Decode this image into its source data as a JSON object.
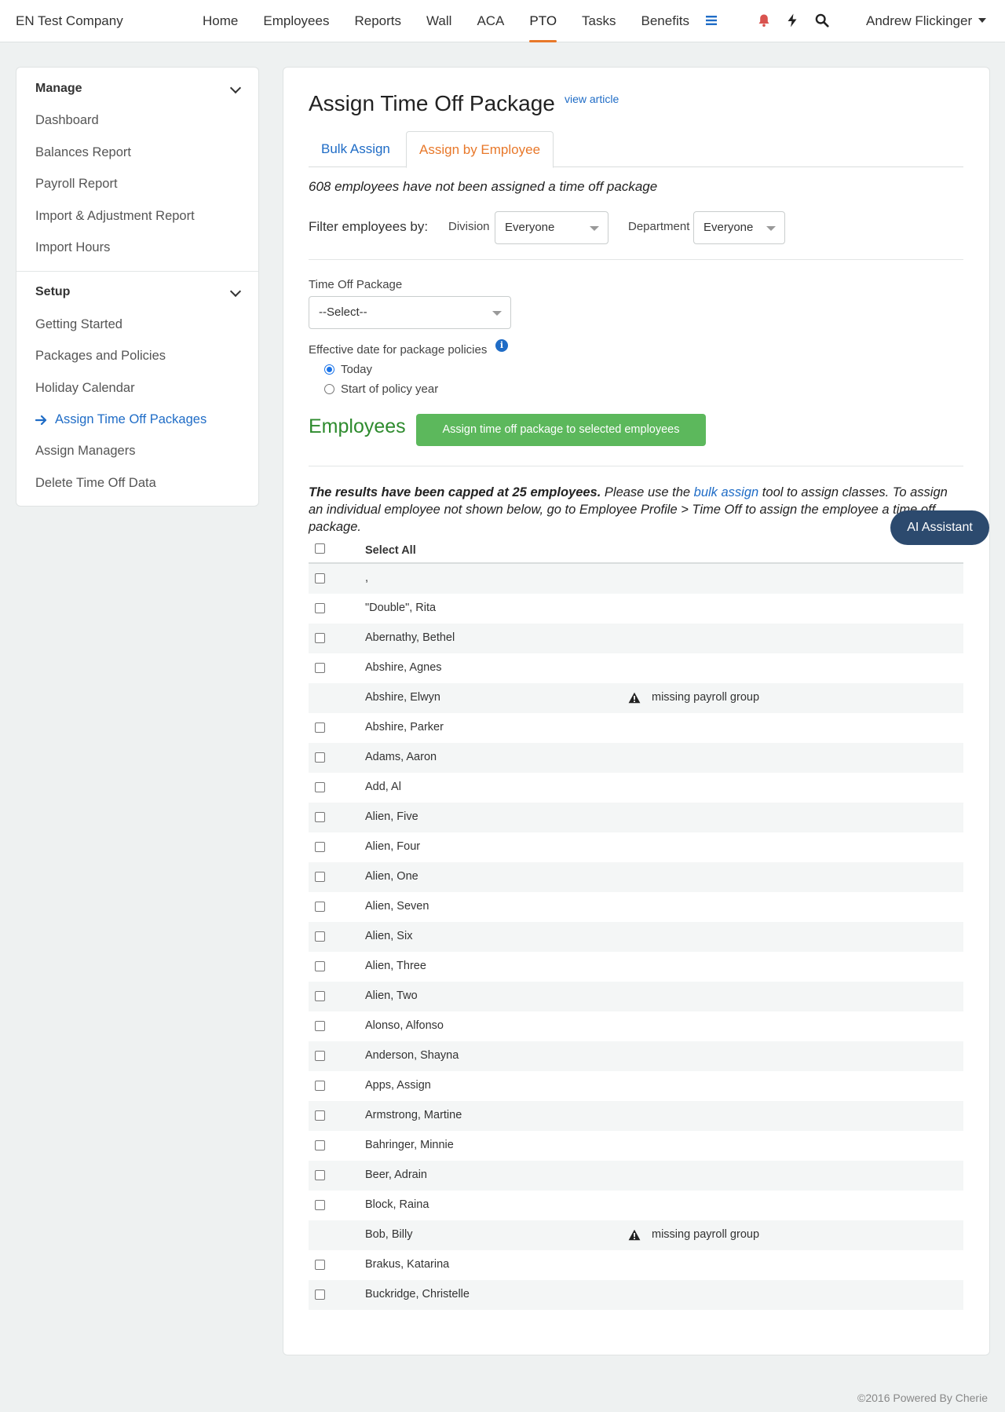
{
  "header": {
    "company": "EN Test Company",
    "nav": [
      "Home",
      "Employees",
      "Reports",
      "Wall",
      "ACA",
      "PTO",
      "Tasks",
      "Benefits"
    ],
    "active_nav": "PTO",
    "user": "Andrew Flickinger",
    "icons": [
      "menu-icon",
      "bell-icon",
      "lightning-icon",
      "search-icon"
    ],
    "colors": {
      "accent": "#e8782a",
      "bell": "#d9534f",
      "menu": "#1f6cc6"
    }
  },
  "sidebar": {
    "manage_title": "Manage",
    "manage_items": [
      "Dashboard",
      "Balances Report",
      "Payroll Report",
      "Import & Adjustment Report",
      "Import Hours"
    ],
    "setup_title": "Setup",
    "setup_items": [
      "Getting Started",
      "Packages and Policies",
      "Holiday Calendar",
      "Assign Time Off Packages",
      "Assign Managers",
      "Delete Time Off Data"
    ],
    "active_item": "Assign Time Off Packages"
  },
  "main": {
    "title": "Assign Time Off Package",
    "view_article": "view article",
    "tabs": [
      "Bulk Assign",
      "Assign by Employee"
    ],
    "active_tab": "Assign by Employee",
    "unassigned_notice": "608 employees have not been assigned a time off package",
    "filter_label": "Filter employees by:",
    "division_label": "Division",
    "division_value": "Everyone",
    "department_label": "Department",
    "department_value": "Everyone",
    "package_label": "Time Off Package",
    "package_value": "--Select--",
    "effective_label": "Effective date for package policies",
    "effective_options": [
      "Today",
      "Start of policy year"
    ],
    "effective_selected": "Today",
    "employees_heading": "Employees",
    "assign_button": "Assign time off package to selected employees",
    "capped_bold": "The results have been capped at 25 employees.",
    "capped_text1": " Please use the ",
    "capped_link": "bulk assign",
    "capped_text2": " tool to assign classes. To assign an individual employee not shown below, go to Employee Profile > Time Off to assign the employee a time off package.",
    "select_all": "Select All",
    "employees": [
      {
        "name": ",",
        "checkbox": true,
        "warning": ""
      },
      {
        "name": "\"Double\", Rita",
        "checkbox": true,
        "warning": ""
      },
      {
        "name": "Abernathy, Bethel",
        "checkbox": true,
        "warning": ""
      },
      {
        "name": "Abshire, Agnes",
        "checkbox": true,
        "warning": ""
      },
      {
        "name": "Abshire, Elwyn",
        "checkbox": false,
        "warning": "missing payroll group"
      },
      {
        "name": "Abshire, Parker",
        "checkbox": true,
        "warning": ""
      },
      {
        "name": "Adams, Aaron",
        "checkbox": true,
        "warning": ""
      },
      {
        "name": "Add, Al",
        "checkbox": true,
        "warning": ""
      },
      {
        "name": "Alien, Five",
        "checkbox": true,
        "warning": ""
      },
      {
        "name": "Alien, Four",
        "checkbox": true,
        "warning": ""
      },
      {
        "name": "Alien, One",
        "checkbox": true,
        "warning": ""
      },
      {
        "name": "Alien, Seven",
        "checkbox": true,
        "warning": ""
      },
      {
        "name": "Alien, Six",
        "checkbox": true,
        "warning": ""
      },
      {
        "name": "Alien, Three",
        "checkbox": true,
        "warning": ""
      },
      {
        "name": "Alien, Two",
        "checkbox": true,
        "warning": ""
      },
      {
        "name": "Alonso, Alfonso",
        "checkbox": true,
        "warning": ""
      },
      {
        "name": "Anderson, Shayna",
        "checkbox": true,
        "warning": ""
      },
      {
        "name": "Apps, Assign",
        "checkbox": true,
        "warning": ""
      },
      {
        "name": "Armstrong, Martine",
        "checkbox": true,
        "warning": ""
      },
      {
        "name": "Bahringer, Minnie",
        "checkbox": true,
        "warning": ""
      },
      {
        "name": "Beer, Adrain",
        "checkbox": true,
        "warning": ""
      },
      {
        "name": "Block, Raina",
        "checkbox": true,
        "warning": ""
      },
      {
        "name": "Bob, Billy",
        "checkbox": false,
        "warning": "missing payroll group"
      },
      {
        "name": "Brakus, Katarina",
        "checkbox": true,
        "warning": ""
      },
      {
        "name": "Buckridge, Christelle",
        "checkbox": true,
        "warning": ""
      }
    ]
  },
  "ai_assistant": "AI Assistant",
  "footer": "©2016 Powered By Cherie"
}
